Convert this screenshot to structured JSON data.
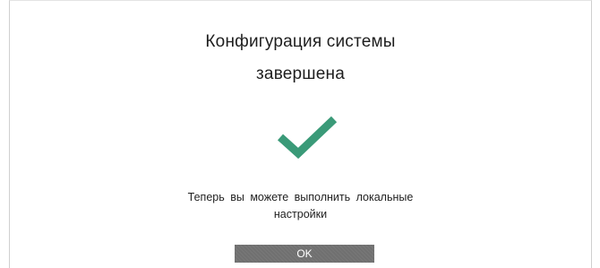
{
  "dialog": {
    "title_line_1": "Конфигурация системы",
    "title_line_2": "завершена",
    "icon": "checkmark-icon",
    "icon_color": "#3a9a78",
    "message_line_1": "Теперь вы можете выполнить локальные",
    "message_line_2": "настройки",
    "ok_label": "OK",
    "ok_button_color": "#707070"
  }
}
